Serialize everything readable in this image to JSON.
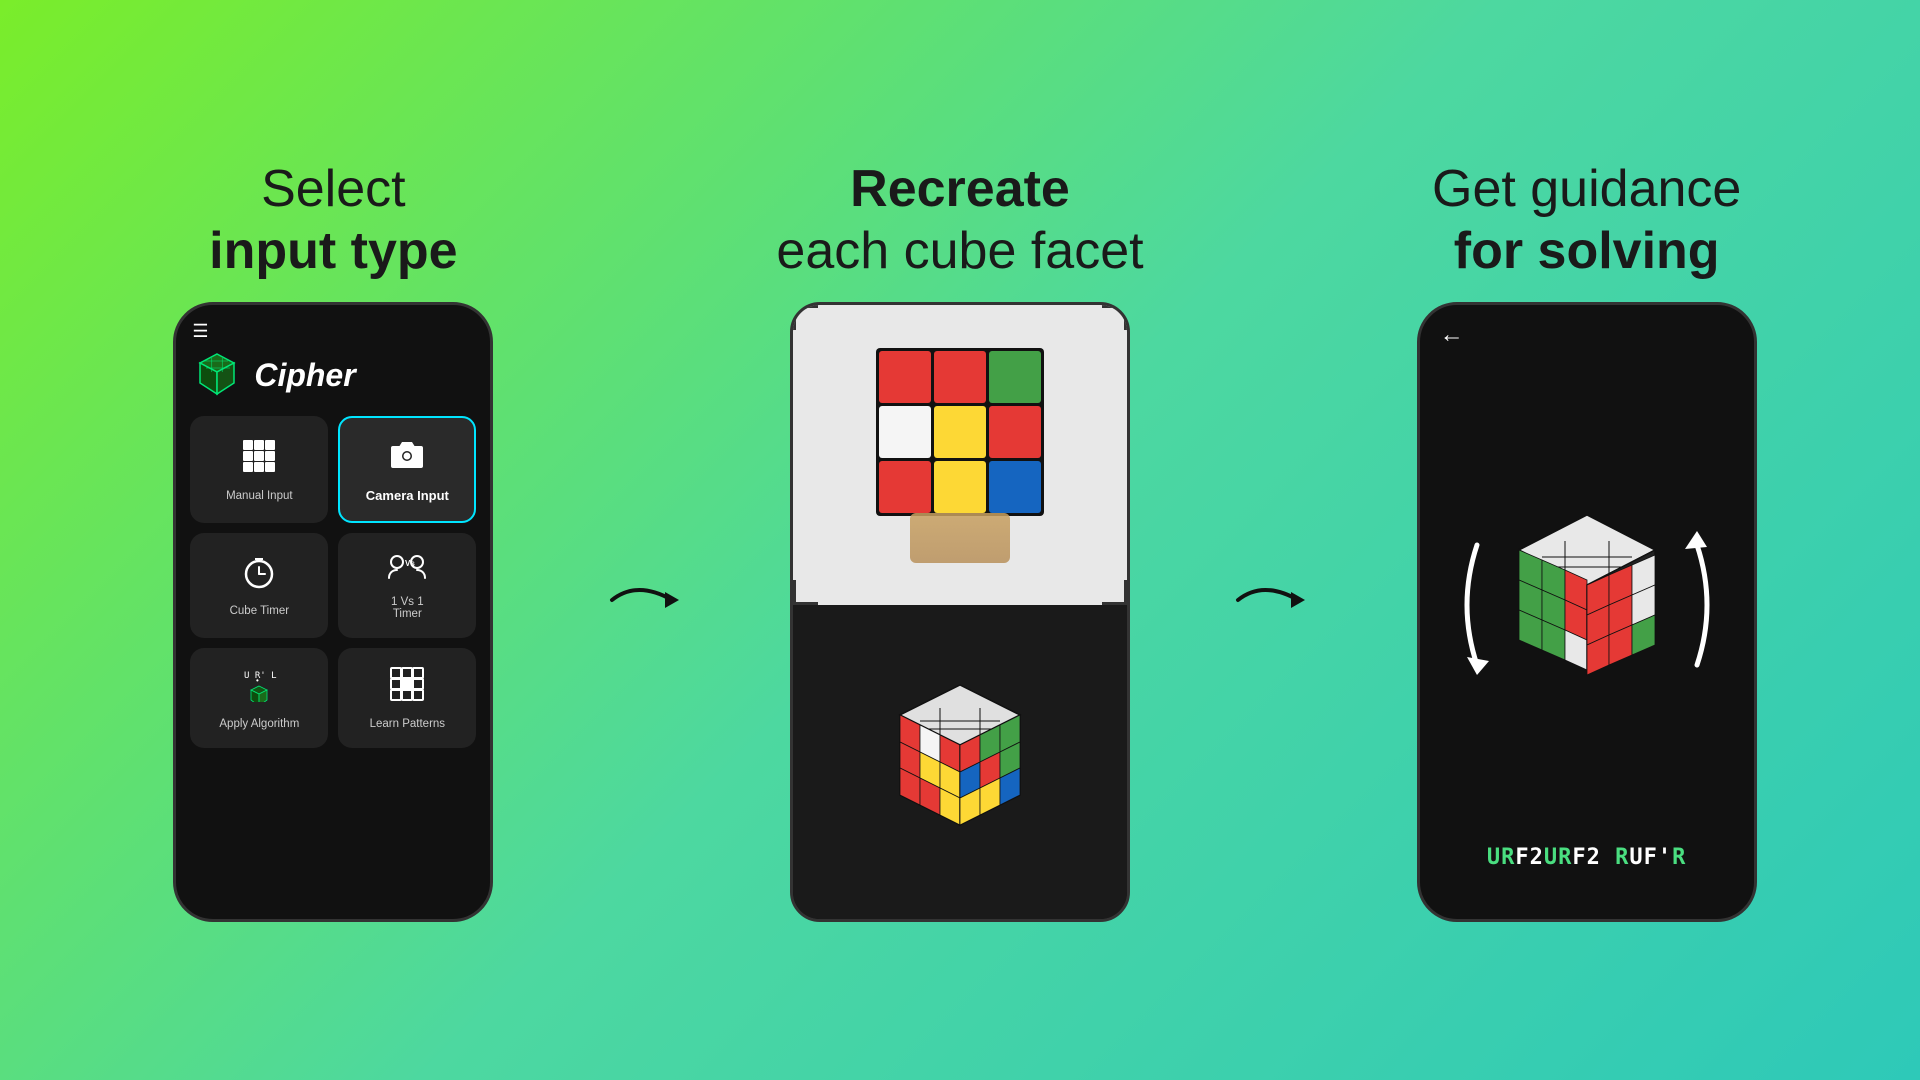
{
  "sections": [
    {
      "id": "section-1",
      "title_line1": "Select",
      "title_line2": "input type",
      "title_bold_line": "input type"
    },
    {
      "id": "section-2",
      "title_line1": "Recreate",
      "title_line2": "each cube facet",
      "title_bold_line": "Recreate"
    },
    {
      "id": "section-3",
      "title_line1": "Get guidance",
      "title_line2": "for solving",
      "title_bold_line": "for solving"
    }
  ],
  "phone_left": {
    "app_name": "Cipher",
    "menu_items": [
      {
        "id": "manual-input",
        "label": "Manual Input",
        "icon": "grid"
      },
      {
        "id": "camera-input",
        "label": "Camera Input",
        "icon": "camera",
        "highlighted": true
      },
      {
        "id": "cube-timer",
        "label": "Cube Timer",
        "icon": "timer"
      },
      {
        "id": "1vs1-timer",
        "label": "1 Vs 1\nTimer",
        "icon": "versus"
      },
      {
        "id": "apply-algorithm",
        "label": "Apply Algorithm",
        "icon": "algorithm"
      },
      {
        "id": "learn-patterns",
        "label": "Learn Patterns",
        "icon": "patterns"
      }
    ]
  },
  "phone_right": {
    "algorithm": "URF2URF2RUF'R",
    "back_label": "←"
  },
  "colors": {
    "background_start": "#7aed2a",
    "background_end": "#2ec9b8",
    "accent_green": "#4ade80",
    "highlight_border": "#00e5ff"
  }
}
